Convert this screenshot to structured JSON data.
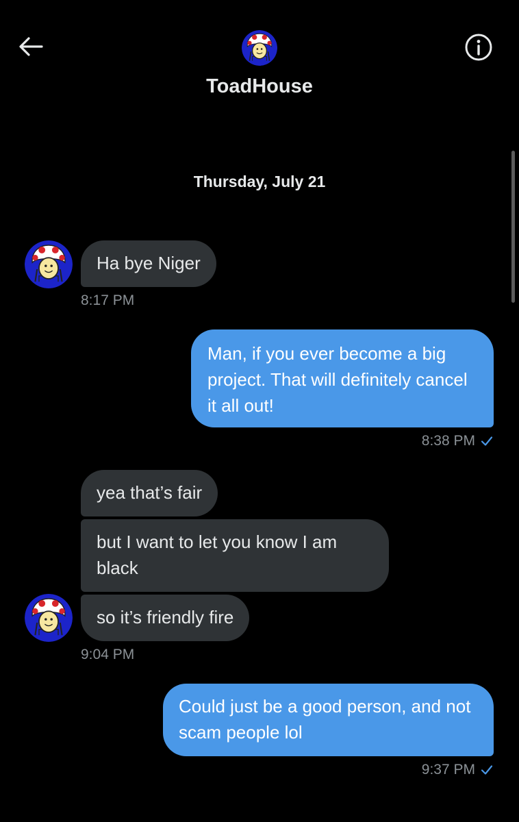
{
  "header": {
    "contact_name": "ToadHouse",
    "back_icon": "arrow-left-icon",
    "info_icon": "info-circle-icon"
  },
  "conversation": {
    "date_divider": "Thursday, July 21",
    "messages": [
      {
        "direction": "incoming",
        "text": "Ha bye Niger"
      },
      {
        "direction": "incoming",
        "time": "8:17 PM"
      },
      {
        "direction": "outgoing",
        "text": "Man, if you ever become a big project. That will definitely cancel it all out!",
        "time": "8:38 PM",
        "status": "sent"
      },
      {
        "direction": "incoming",
        "text": "yea that’s fair"
      },
      {
        "direction": "incoming",
        "text": "but I want to let you know I am black"
      },
      {
        "direction": "incoming",
        "text": "so it’s friendly fire",
        "time": "9:04 PM"
      },
      {
        "direction": "outgoing",
        "text": "Could just be a good person, and not scam people lol",
        "time": "9:37 PM",
        "status": "sent"
      }
    ]
  },
  "colors": {
    "background": "#000000",
    "incoming_bubble": "#2f3336",
    "outgoing_bubble": "#4a98e8",
    "timestamp": "#8b9196",
    "check": "#4a98e8",
    "avatar_ring": "#1a22c8"
  }
}
